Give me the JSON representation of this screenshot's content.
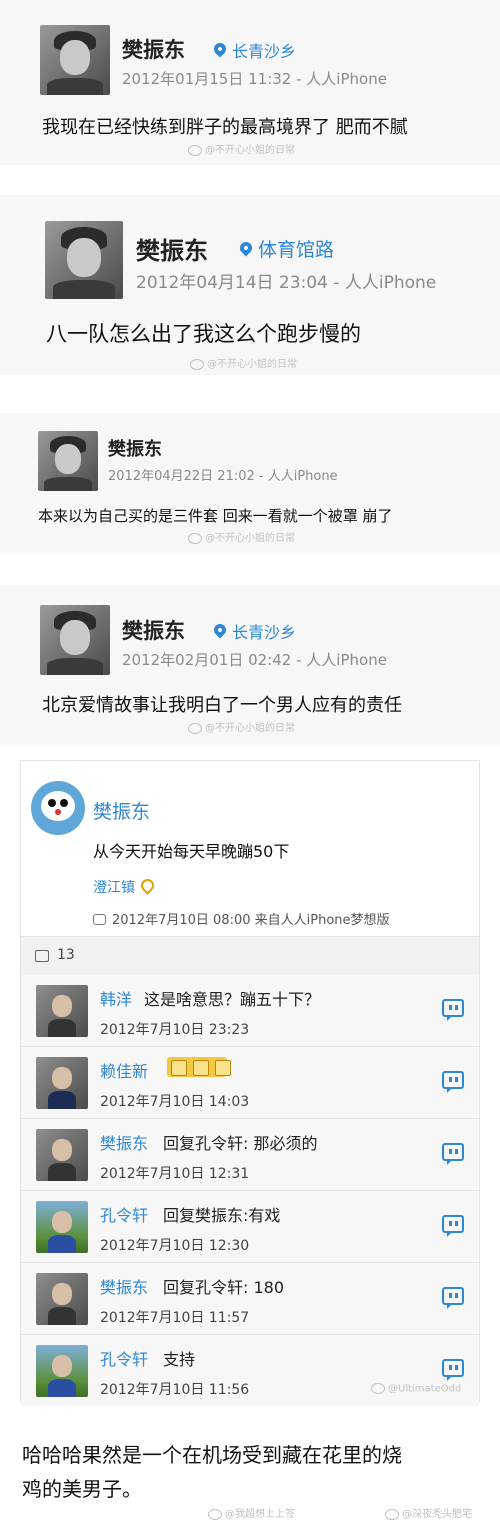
{
  "posts": [
    {
      "name": "樊振东",
      "location": "长青沙乡",
      "meta": "2012年01月15日 11:32 - 人人iPhone",
      "text": "我现在已经快练到胖子的最高境界了 肥而不腻",
      "watermark": "@不开心小姐的日常"
    },
    {
      "name": "樊振东",
      "location": "体育馆路",
      "meta": "2012年04月14日 23:04 - 人人iPhone",
      "text": "八一队怎么出了我这么个跑步慢的",
      "watermark": "@不开心小姐的日常"
    },
    {
      "name": "樊振东",
      "location": "",
      "meta": "2012年04月22日 21:02 - 人人iPhone",
      "text": "本来以为自己买的是三件套 回来一看就一个被罩 崩了",
      "watermark": "@不开心小姐的日常"
    },
    {
      "name": "樊振东",
      "location": "长青沙乡",
      "meta": "2012年02月01日 02:42 - 人人iPhone",
      "text": "北京爱情故事让我明白了一个男人应有的责任",
      "watermark": "@不开心小姐的日常"
    }
  ],
  "post5": {
    "name": "樊振东",
    "text": "从今天开始每天早晚蹦50下",
    "location": "澄江镇",
    "time": "2012年7月10日 08:00 来自人人iPhone梦想版",
    "comment_count": "13",
    "comments": [
      {
        "name": "韩洋",
        "text": "这是啥意思？蹦五十下？",
        "date": "2012年7月10日 23:23"
      },
      {
        "name": "赖佳新",
        "text": "",
        "date": "2012年7月10日 14:03"
      },
      {
        "name": "樊振东",
        "text": "回复孔令轩: 那必须的",
        "date": "2012年7月10日 12:31"
      },
      {
        "name": "孔令轩",
        "text": "回复樊振东:有戏",
        "date": "2012年7月10日 12:30"
      },
      {
        "name": "樊振东",
        "text": "回复孔令轩: 180",
        "date": "2012年7月10日 11:57"
      },
      {
        "name": "孔令轩",
        "text": "支持",
        "date": "2012年7月10日 11:56"
      }
    ],
    "watermark": "@UltimateOdd"
  },
  "caption": {
    "line1": "哈哈哈果然是一个在机场受到藏在花里的烧",
    "line2": "鸡的美男子。"
  },
  "bottom_watermarks": [
    "@我超想上上签",
    "@深夜秃头肥宅"
  ]
}
